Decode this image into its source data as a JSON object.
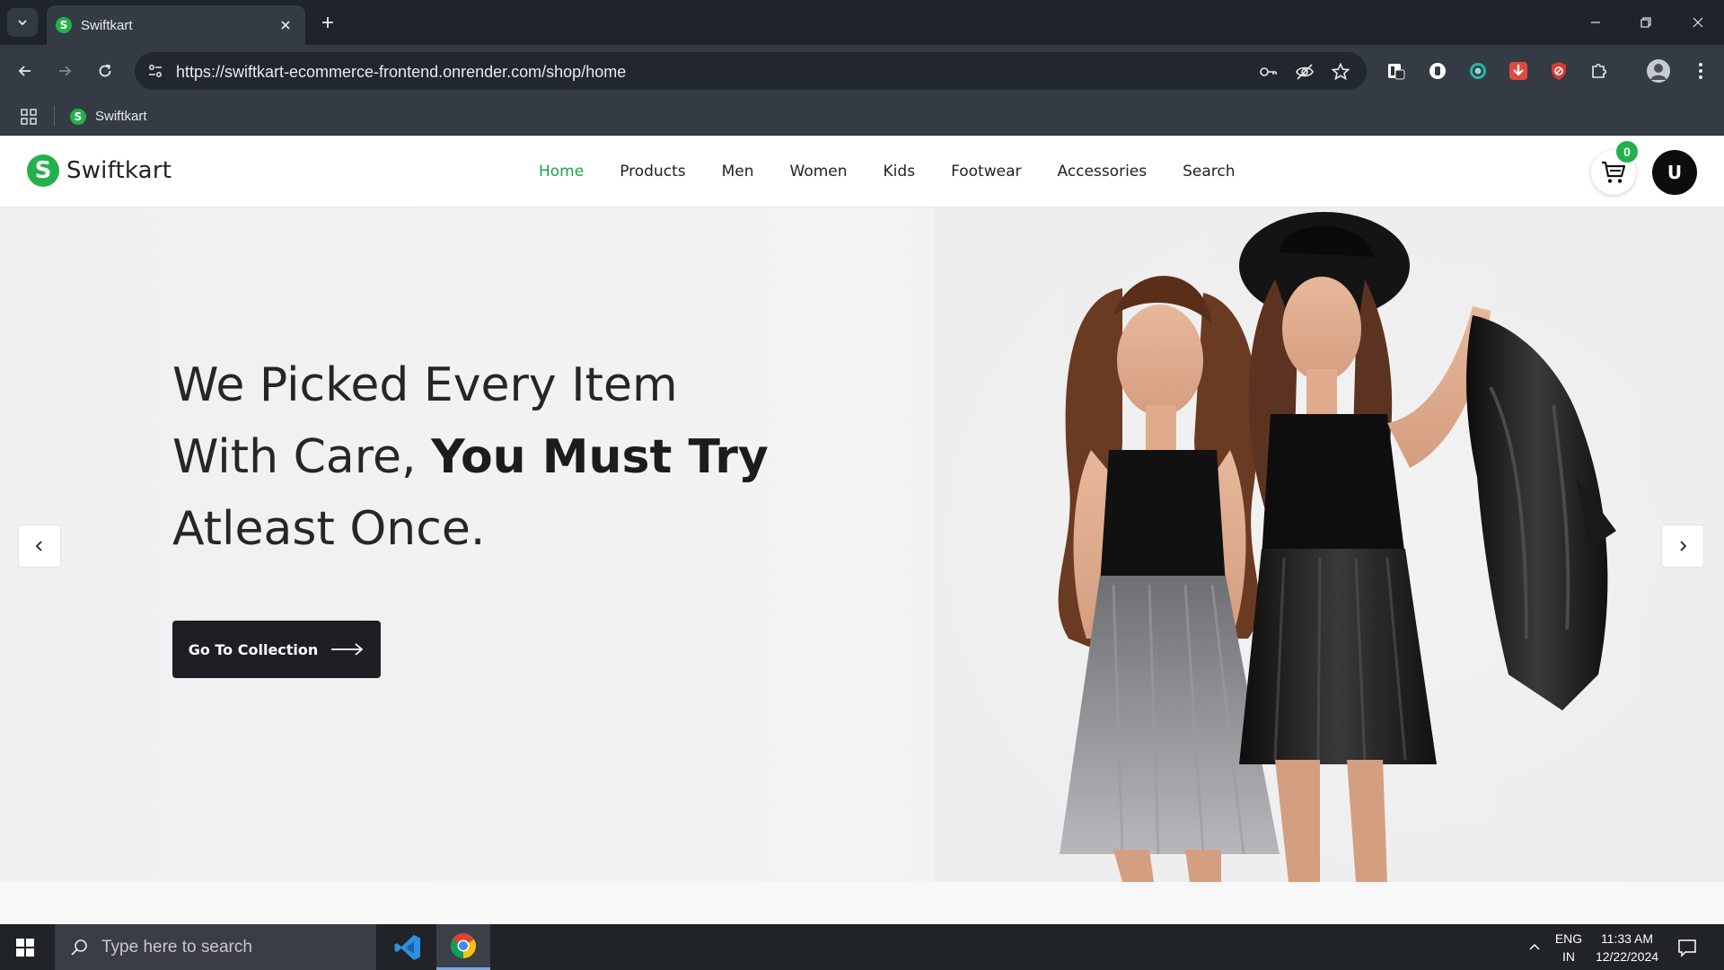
{
  "browser": {
    "tab": {
      "title": "Swiftkart",
      "favicon_letter": "S"
    },
    "url": "https://swiftkart-ecommerce-frontend.onrender.com/shop/home",
    "bookmarks": [
      {
        "label": "Swiftkart",
        "favicon_letter": "S"
      }
    ]
  },
  "site": {
    "logo": {
      "mark": "S",
      "name": "Swiftkart"
    },
    "nav": [
      {
        "label": "Home",
        "active": true
      },
      {
        "label": "Products"
      },
      {
        "label": "Men"
      },
      {
        "label": "Women"
      },
      {
        "label": "Kids"
      },
      {
        "label": "Footwear"
      },
      {
        "label": "Accessories"
      },
      {
        "label": "Search"
      }
    ],
    "cart_count": "0",
    "user_initial": "U",
    "accent_color": "#22b14c"
  },
  "hero": {
    "line1": "We Picked Every Item",
    "line2_regular": "With Care, ",
    "line2_bold": "You Must Try",
    "line3": "Atleast Once.",
    "cta_label": "Go To Collection"
  },
  "taskbar": {
    "search_placeholder": "Type here to search",
    "lang_line1": "ENG",
    "lang_line2": "IN",
    "time": "11:33 AM",
    "date": "12/22/2024"
  }
}
